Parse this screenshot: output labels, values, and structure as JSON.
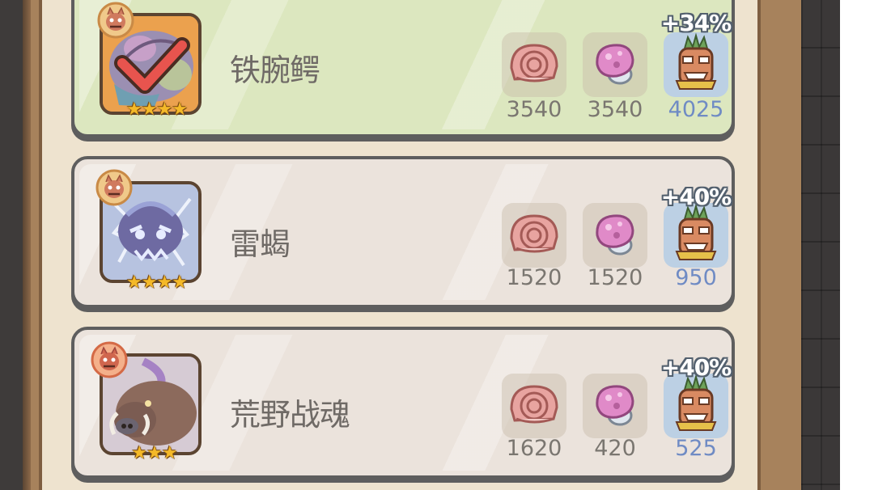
{
  "bonus_records": [
    {
      "name": "铁腕鳄",
      "completed": true,
      "stars": 4,
      "bonus": "+34%",
      "materials": [
        {
          "icon": "pink-shell-icon",
          "value": "3540"
        },
        {
          "icon": "pink-crystal-icon",
          "value": "3540"
        },
        {
          "icon": "tribal-mask-icon",
          "value": "4025"
        }
      ]
    },
    {
      "name": "雷蝎",
      "completed": false,
      "stars": 4,
      "bonus": "+40%",
      "materials": [
        {
          "icon": "pink-shell-icon",
          "value": "1520"
        },
        {
          "icon": "pink-crystal-icon",
          "value": "1520"
        },
        {
          "icon": "tribal-mask-icon",
          "value": "950"
        }
      ]
    },
    {
      "name": "荒野战魂",
      "completed": false,
      "stars": 3,
      "bonus": "+40%",
      "materials": [
        {
          "icon": "pink-shell-icon",
          "value": "1620"
        },
        {
          "icon": "pink-crystal-icon",
          "value": "420"
        },
        {
          "icon": "tribal-mask-icon",
          "value": "525"
        }
      ]
    }
  ],
  "colors": {
    "completed_card": "#dce7bf",
    "normal_card": "#ebe3dc",
    "highlight_value": "#6f8bc4",
    "normal_value": "#7a7670",
    "check_mark": "#e8544e",
    "star": "#f4b928"
  }
}
